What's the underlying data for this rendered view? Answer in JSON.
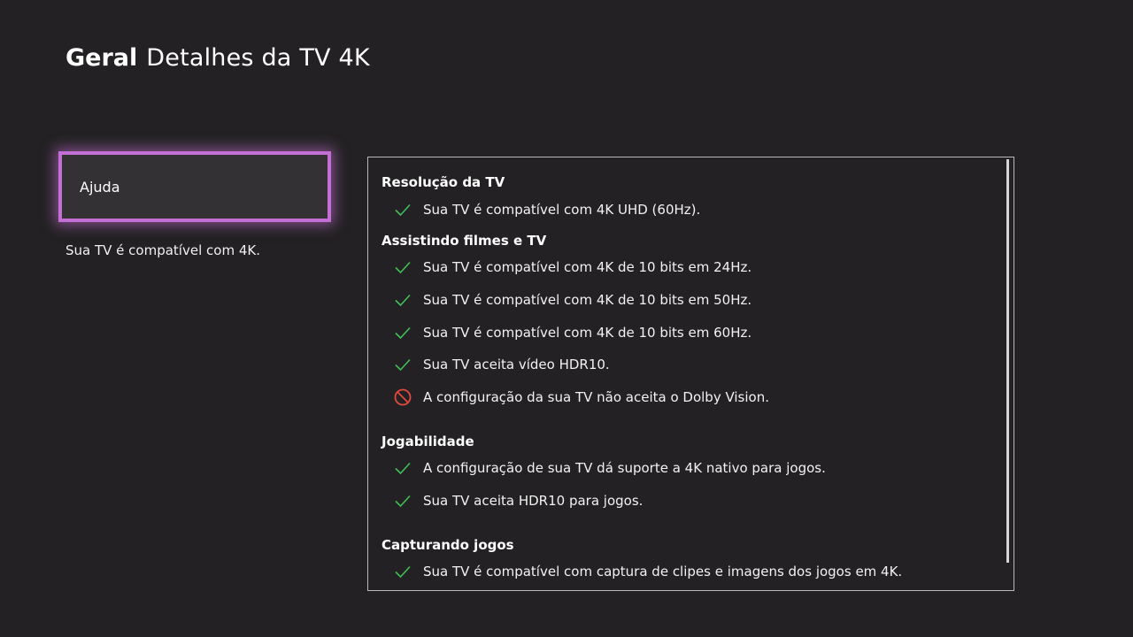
{
  "header": {
    "section": "Geral",
    "title": "Detalhes da TV 4K"
  },
  "help_button": {
    "label": "Ajuda"
  },
  "summary": "Sua TV é compatível com 4K.",
  "colors": {
    "accent": "#c46fd6",
    "check": "#3fbf5a",
    "blocked": "#e24b3d",
    "background": "#232123"
  },
  "details": {
    "resolution": {
      "title": "Resolução da TV",
      "items": [
        {
          "icon": "check-icon",
          "text": "Sua TV é compatível com 4K UHD (60Hz)."
        }
      ]
    },
    "movies": {
      "title": "Assistindo filmes e TV",
      "items": [
        {
          "icon": "check-icon",
          "text": "Sua TV é compatível com 4K de 10 bits em 24Hz."
        },
        {
          "icon": "check-icon",
          "text": "Sua TV é compatível com 4K de 10 bits em 50Hz."
        },
        {
          "icon": "check-icon",
          "text": "Sua TV é compatível com 4K de 10 bits em 60Hz."
        },
        {
          "icon": "check-icon",
          "text": "Sua TV aceita vídeo HDR10."
        },
        {
          "icon": "blocked-icon",
          "text": "A configuração da sua TV não aceita o Dolby Vision."
        }
      ]
    },
    "gaming": {
      "title": "Jogabilidade",
      "items": [
        {
          "icon": "check-icon",
          "text": "A configuração de sua TV dá suporte a 4K nativo para jogos."
        },
        {
          "icon": "check-icon",
          "text": "Sua TV aceita HDR10 para jogos."
        }
      ]
    },
    "capture": {
      "title": "Capturando jogos",
      "items": [
        {
          "icon": "check-icon",
          "text": "Sua TV é compatível com captura de clipes e imagens dos jogos em 4K."
        }
      ]
    }
  }
}
